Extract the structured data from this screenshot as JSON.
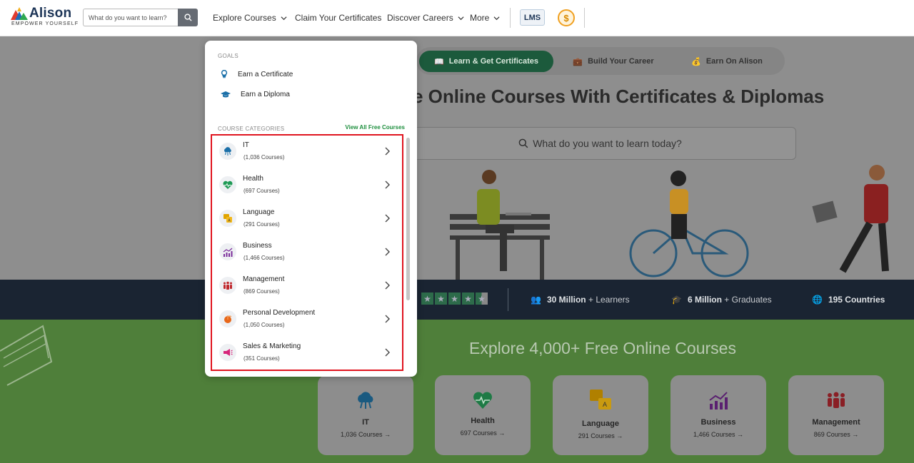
{
  "brand": {
    "name": "Alison",
    "tagline": "EMPOWER YOURSELF"
  },
  "header": {
    "search_placeholder": "What do you want to learn?",
    "nav": [
      {
        "label": "Explore Courses",
        "has_chevron": true
      },
      {
        "label": "Claim Your Certificates",
        "has_chevron": false
      },
      {
        "label": "Discover Careers",
        "has_chevron": true
      },
      {
        "label": "More",
        "has_chevron": true
      }
    ],
    "lms_label": "LMS",
    "coin_label": "$"
  },
  "hero": {
    "tabs": [
      {
        "label": "Learn & Get Certificates",
        "icon": "book-icon",
        "active": true
      },
      {
        "label": "Build Your Career",
        "icon": "briefcase-icon",
        "active": false
      },
      {
        "label": "Earn On Alison",
        "icon": "money-icon",
        "active": false
      }
    ],
    "title": "e Online Courses With Certificates & Diplomas",
    "search_placeholder": "What do you want to learn today?"
  },
  "stats": {
    "learners": {
      "bold": "30 Million",
      "rest": " + Learners"
    },
    "graduates": {
      "bold": "6 Million",
      "rest": " + Graduates"
    },
    "countries": {
      "bold": "195 Countries",
      "rest": ""
    }
  },
  "explore": {
    "title": "Explore 4,000+ Free Online Courses",
    "cards": [
      {
        "name": "IT",
        "count": "1,036 Courses →"
      },
      {
        "name": "Health",
        "count": "697 Courses →"
      },
      {
        "name": "Language",
        "count": "291 Courses →"
      },
      {
        "name": "Business",
        "count": "1,466 Courses →"
      },
      {
        "name": "Management",
        "count": "869 Courses →"
      }
    ]
  },
  "dropdown": {
    "goals_heading": "GOALS",
    "goals": [
      {
        "label": "Earn a Certificate",
        "icon": "certificate-icon"
      },
      {
        "label": "Earn a Diploma",
        "icon": "graduation-cap-icon"
      }
    ],
    "categories_heading": "COURSE CATEGORIES",
    "view_all": "View All Free Courses",
    "categories": [
      {
        "name": "IT",
        "count": "(1,036 Courses)",
        "icon": "cloud-icon",
        "color": "#1a6fa8"
      },
      {
        "name": "Health",
        "count": "(697 Courses)",
        "icon": "heart-icon",
        "color": "#1e9a55"
      },
      {
        "name": "Language",
        "count": "(291 Courses)",
        "icon": "translate-icon",
        "color": "#e0a400"
      },
      {
        "name": "Business",
        "count": "(1,466 Courses)",
        "icon": "chart-icon",
        "color": "#7b2d9a"
      },
      {
        "name": "Management",
        "count": "(869 Courses)",
        "icon": "team-icon",
        "color": "#c0282d"
      },
      {
        "name": "Personal Development",
        "count": "(1,050 Courses)",
        "icon": "growth-icon",
        "color": "#e8671a"
      },
      {
        "name": "Sales & Marketing",
        "count": "(351 Courses)",
        "icon": "megaphone-icon",
        "color": "#d6257a"
      }
    ]
  }
}
